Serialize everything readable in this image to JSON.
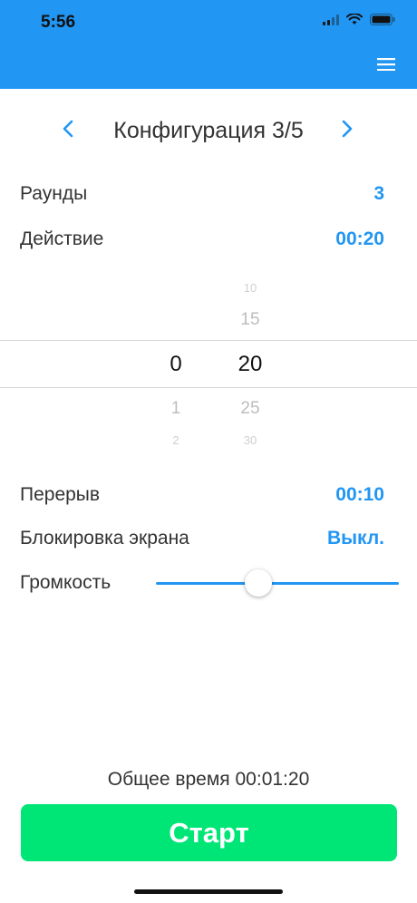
{
  "status_bar": {
    "time": "5:56"
  },
  "config": {
    "title": "Конфигурация 3/5"
  },
  "settings": {
    "rounds": {
      "label": "Раунды",
      "value": "3"
    },
    "action": {
      "label": "Действие",
      "value": "00:20"
    },
    "rest": {
      "label": "Перерыв",
      "value": "00:10"
    },
    "screen_lock": {
      "label": "Блокировка экрана",
      "value": "Выкл."
    },
    "volume": {
      "label": "Громкость",
      "level": 0.42
    }
  },
  "picker": {
    "minutes": {
      "selected": "0",
      "below": [
        "1",
        "2"
      ]
    },
    "seconds": {
      "above": [
        "10",
        "15"
      ],
      "selected": "20",
      "below": [
        "25",
        "30"
      ]
    }
  },
  "footer": {
    "total_time": "Общее время 00:01:20",
    "start_label": "Старт"
  },
  "colors": {
    "accent": "#2196f3",
    "start": "#00e676"
  },
  "icons": {
    "menu": "hamburger-icon",
    "prev": "chevron-left-icon",
    "next": "chevron-right-icon"
  }
}
